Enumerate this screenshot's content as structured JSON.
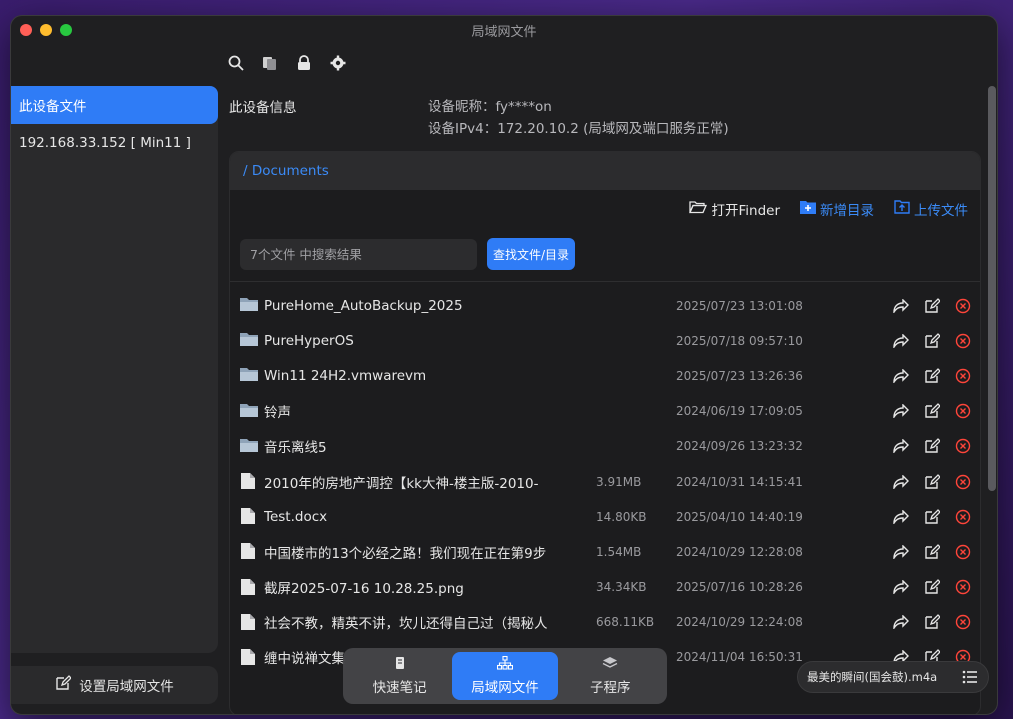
{
  "window": {
    "title": "局域网文件"
  },
  "sidebar": {
    "items": [
      {
        "label": "此设备文件",
        "active": true
      },
      {
        "label": "192.168.33.152 [ Min11 ]",
        "active": false
      }
    ],
    "bottom_button": "设置局域网文件"
  },
  "toolbar": {
    "icons": [
      "search-icon",
      "copy-icon",
      "lock-icon",
      "gear-icon"
    ]
  },
  "device_info": {
    "label": "此设备信息",
    "nickname": "设备昵称：fy****on",
    "ipv4": "设备IPv4：172.20.10.2 (局域网及端口服务正常)"
  },
  "browser": {
    "path": "/ Documents",
    "open_finder": "打开Finder",
    "new_dir": "新增目录",
    "upload": "上传文件",
    "search_placeholder": "7个文件 中搜索结果",
    "search_button": "查找文件/目录",
    "files": [
      {
        "type": "folder",
        "name": "PureHome_AutoBackup_2025",
        "size": "",
        "date": "2025/07/23 13:01:08"
      },
      {
        "type": "folder",
        "name": "PureHyperOS",
        "size": "",
        "date": "2025/07/18 09:57:10"
      },
      {
        "type": "folder",
        "name": "Win11 24H2.vmwarevm",
        "size": "",
        "date": "2025/07/23 13:26:36"
      },
      {
        "type": "folder",
        "name": "铃声",
        "size": "",
        "date": "2024/06/19 17:09:05"
      },
      {
        "type": "folder",
        "name": "音乐离线5",
        "size": "",
        "date": "2024/09/26 13:23:32"
      },
      {
        "type": "file",
        "name": "2010年的房地产调控【kk大神-楼主版-2010-",
        "size": "3.91MB",
        "date": "2024/10/31 14:15:41"
      },
      {
        "type": "file",
        "name": "Test.docx",
        "size": "14.80KB",
        "date": "2025/04/10 14:40:19"
      },
      {
        "type": "file",
        "name": "中国楼市的13个必经之路！我们现在正在第9步",
        "size": "1.54MB",
        "date": "2024/10/29 12:28:08"
      },
      {
        "type": "file",
        "name": "截屏2025-07-16 10.28.25.png",
        "size": "34.34KB",
        "date": "2025/07/16 10:28:26"
      },
      {
        "type": "file",
        "name": "社会不教，精英不讲，坎儿还得自己过（揭秘人",
        "size": "668.11KB",
        "date": "2024/10/29 12:24:08"
      },
      {
        "type": "file",
        "name": "缠中说禅文集",
        "size": "",
        "date": "2024/11/04 16:50:31"
      }
    ]
  },
  "dock": {
    "items": [
      {
        "label": "快速笔记",
        "active": false
      },
      {
        "label": "局域网文件",
        "active": true
      },
      {
        "label": "子程序",
        "active": false
      }
    ]
  },
  "player": {
    "track": "最美的瞬间(国会鼓).m4a"
  },
  "colors": {
    "accent": "#2f7cf6",
    "danger": "#ff453a",
    "link": "#3b8bf7"
  }
}
